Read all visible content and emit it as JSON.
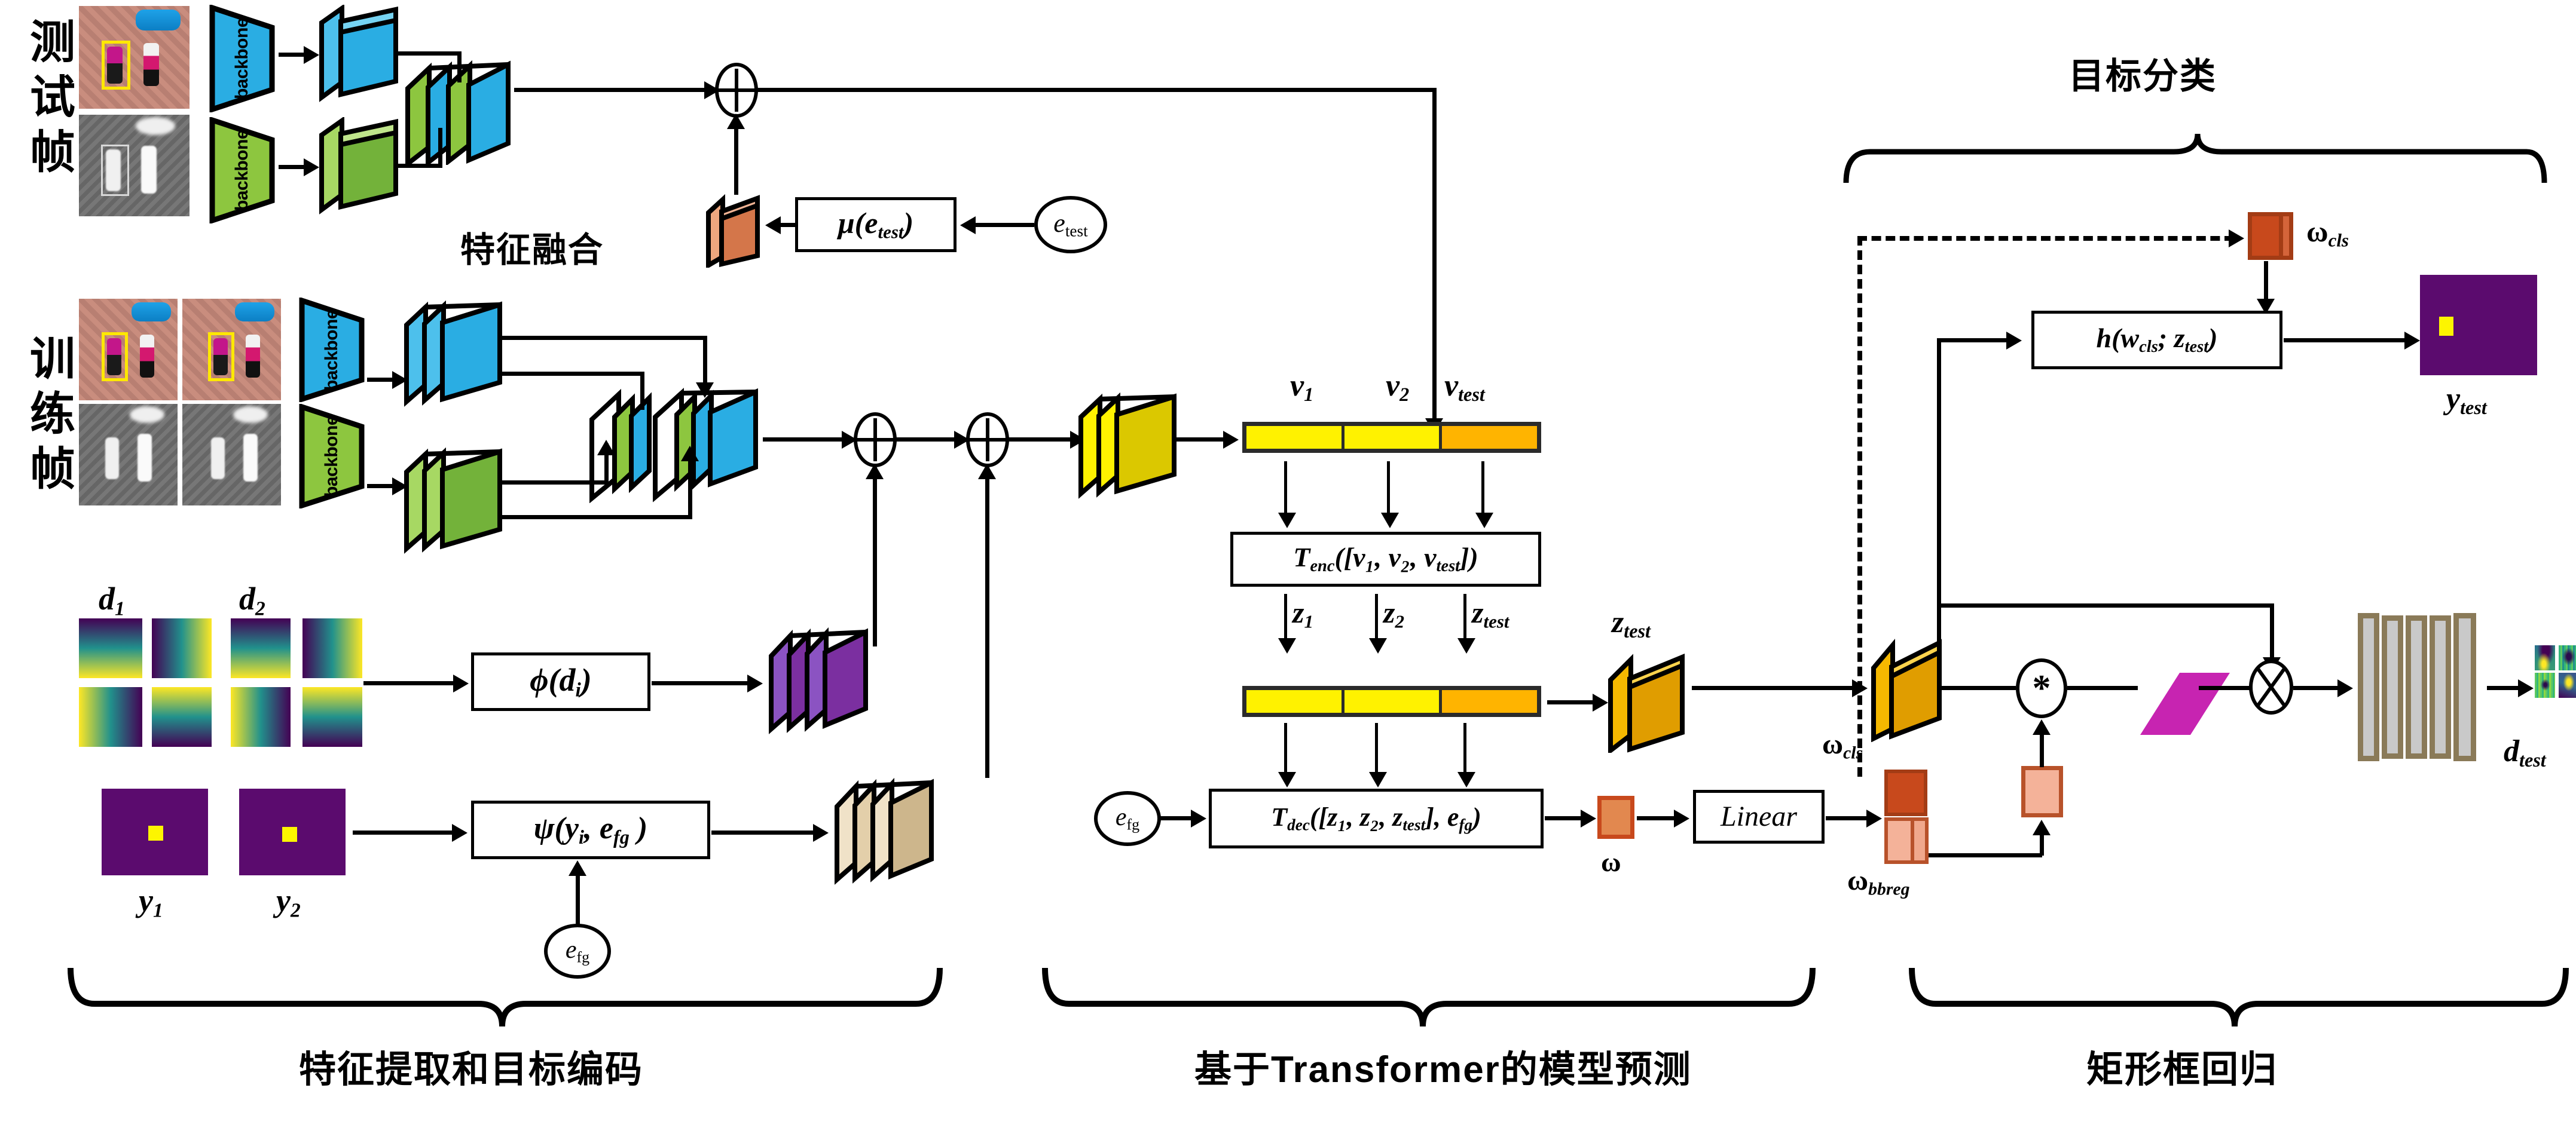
{
  "figure": {
    "type": "architecture-diagram",
    "title_present": false
  },
  "row_labels": {
    "test_frame": "测试帧",
    "train_frame": "训练帧"
  },
  "inline_labels": {
    "feature_fusion": "特征融合",
    "target_classification": "目标分类"
  },
  "backbones": [
    {
      "id": "test-rgb",
      "label": "backbone",
      "color": "#2aade3"
    },
    {
      "id": "test-ir",
      "label": "backbone",
      "color": "#8dc63f"
    },
    {
      "id": "train-rgb",
      "label": "backbone",
      "color": "#2aade3"
    },
    {
      "id": "train-ir",
      "label": "backbone",
      "color": "#8dc63f"
    }
  ],
  "function_boxes": {
    "mu_test": "μ(e",
    "mu_test_sub": "test",
    "mu_test_close": ")",
    "phi": "ϕ(d",
    "phi_sub": "i",
    "phi_close": ")",
    "psi": "ψ(y",
    "psi_sub": "i",
    "psi_mid": ", e",
    "psi_sub2": "fg",
    "psi_close": " )",
    "t_enc": "T",
    "t_enc_sub": "enc",
    "t_enc_args": "([v₁, v₂, v",
    "t_enc_args_sub": "test",
    "t_enc_args_close": "])",
    "t_dec": "T",
    "t_dec_sub": "dec",
    "t_dec_args": "([z₁, z₂, z",
    "t_dec_args_sub": "test",
    "t_dec_args_mid": "], e",
    "t_dec_args_sub2": "fg",
    "t_dec_args_close": ")",
    "linear": "Linear",
    "h_cls": "h(w",
    "h_cls_sub": "cls",
    "h_cls_mid": "; z",
    "h_cls_sub2": "test",
    "h_cls_close": ")"
  },
  "ellipse_nodes": [
    {
      "id": "e-test",
      "base": "e",
      "sub": "test"
    },
    {
      "id": "e-fg-dec",
      "base": "e",
      "sub": "fg"
    },
    {
      "id": "e-fg-psi",
      "base": "e",
      "sub": "fg"
    }
  ],
  "variable_labels": {
    "d1": {
      "base": "d",
      "sub": "1"
    },
    "d2": {
      "base": "d",
      "sub": "2"
    },
    "y1": {
      "base": "y",
      "sub": "1"
    },
    "y2": {
      "base": "y",
      "sub": "2"
    },
    "v1": {
      "base": "v",
      "sub": "1"
    },
    "v2": {
      "base": "v",
      "sub": "2"
    },
    "v_test": {
      "base": "v",
      "sub": "test"
    },
    "z1": {
      "base": "z",
      "sub": "1"
    },
    "z2": {
      "base": "z",
      "sub": "2"
    },
    "z_test_arrow": {
      "base": "z",
      "sub": "test"
    },
    "z_test_cube": {
      "base": "z",
      "sub": "test"
    },
    "omega": {
      "base": "ω",
      "sub": ""
    },
    "omega_cls_top": {
      "base": "ω",
      "sub": "cls"
    },
    "omega_cls_mid": {
      "base": "ω",
      "sub": "cls"
    },
    "omega_bbreg": {
      "base": "ω",
      "sub": "bbreg"
    },
    "y_test": {
      "base": "y",
      "sub": "test"
    },
    "d_test": {
      "base": "d",
      "sub": "test"
    }
  },
  "operators": [
    {
      "id": "add-test-fusion",
      "glyph": "⊕",
      "name": "element-wise-add"
    },
    {
      "id": "add-train-1",
      "glyph": "⊕",
      "name": "element-wise-add"
    },
    {
      "id": "add-train-2",
      "glyph": "⊕",
      "name": "element-wise-add"
    },
    {
      "id": "conv-star",
      "glyph": "*",
      "name": "convolution"
    },
    {
      "id": "mul-cross",
      "glyph": "⊗",
      "name": "element-wise-multiply"
    }
  ],
  "section_captions": [
    {
      "id": "sec-feature",
      "label": "特征提取和目标编码"
    },
    {
      "id": "sec-transformer",
      "label": "基于Transformer的模型预测"
    },
    {
      "id": "sec-bbreg",
      "label": "矩形框回归"
    }
  ],
  "colors": {
    "rgb_branch": "#2aade3",
    "ir_branch": "#8dc63f",
    "fusion_orange": "#e2884f",
    "token_yellow": "#fff200",
    "token_orange": "#ffb400",
    "z_cube_gold": "#f5b800",
    "weight_dark_orange": "#c8491c",
    "weight_light_orange": "#f4b299",
    "purple_cube": "#7b2fa0",
    "tan_cube": "#e3cfaa",
    "magenta_plane": "#c724b1",
    "gray_conv": "#c9c9c9",
    "gray_conv_border": "#8a7a58",
    "mask_purple": "#5b0b6e",
    "mask_dot_yellow": "#fdf500",
    "bbox_yellow": "#ffe800"
  }
}
